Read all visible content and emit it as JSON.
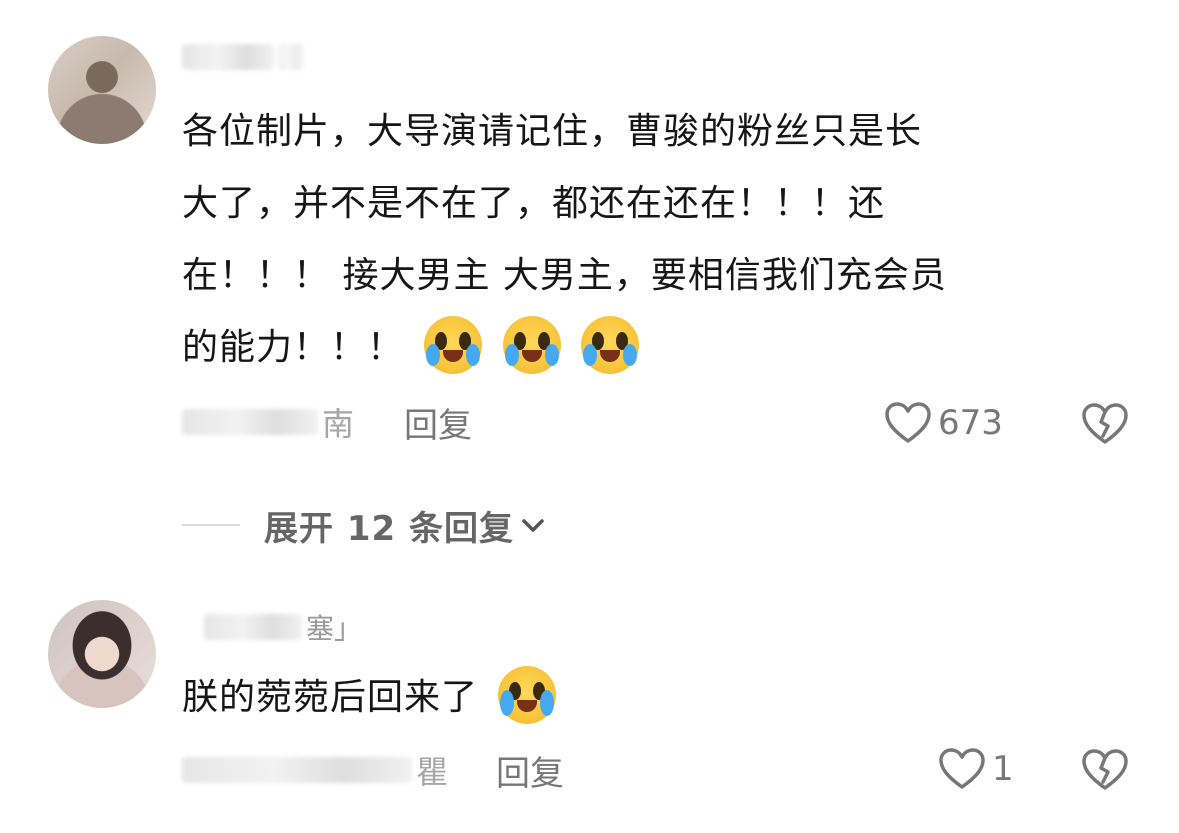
{
  "comments": [
    {
      "name_suffix": "",
      "text_lines": [
        "各位制片，大导演请记住，曹骏的粉丝只是长",
        "大了，并不是不在了，都还在还在！！！还",
        "在！！！ 接大男主 大男主，要相信我们充会员",
        "的能力！！！"
      ],
      "emojis": [
        "tear-joy-emoji",
        "tear-joy-emoji",
        "tear-joy-emoji"
      ],
      "meta_suffix": "南",
      "reply_label": "回复",
      "like_count": "673"
    },
    {
      "name_suffix": "塞」",
      "text": "朕的菀菀后回来了",
      "emojis": [
        "crying-emoji"
      ],
      "meta_suffix": "瞿",
      "reply_label": "回复",
      "like_count": "1"
    }
  ],
  "expand_replies": {
    "label": "展开 12 条回复"
  }
}
